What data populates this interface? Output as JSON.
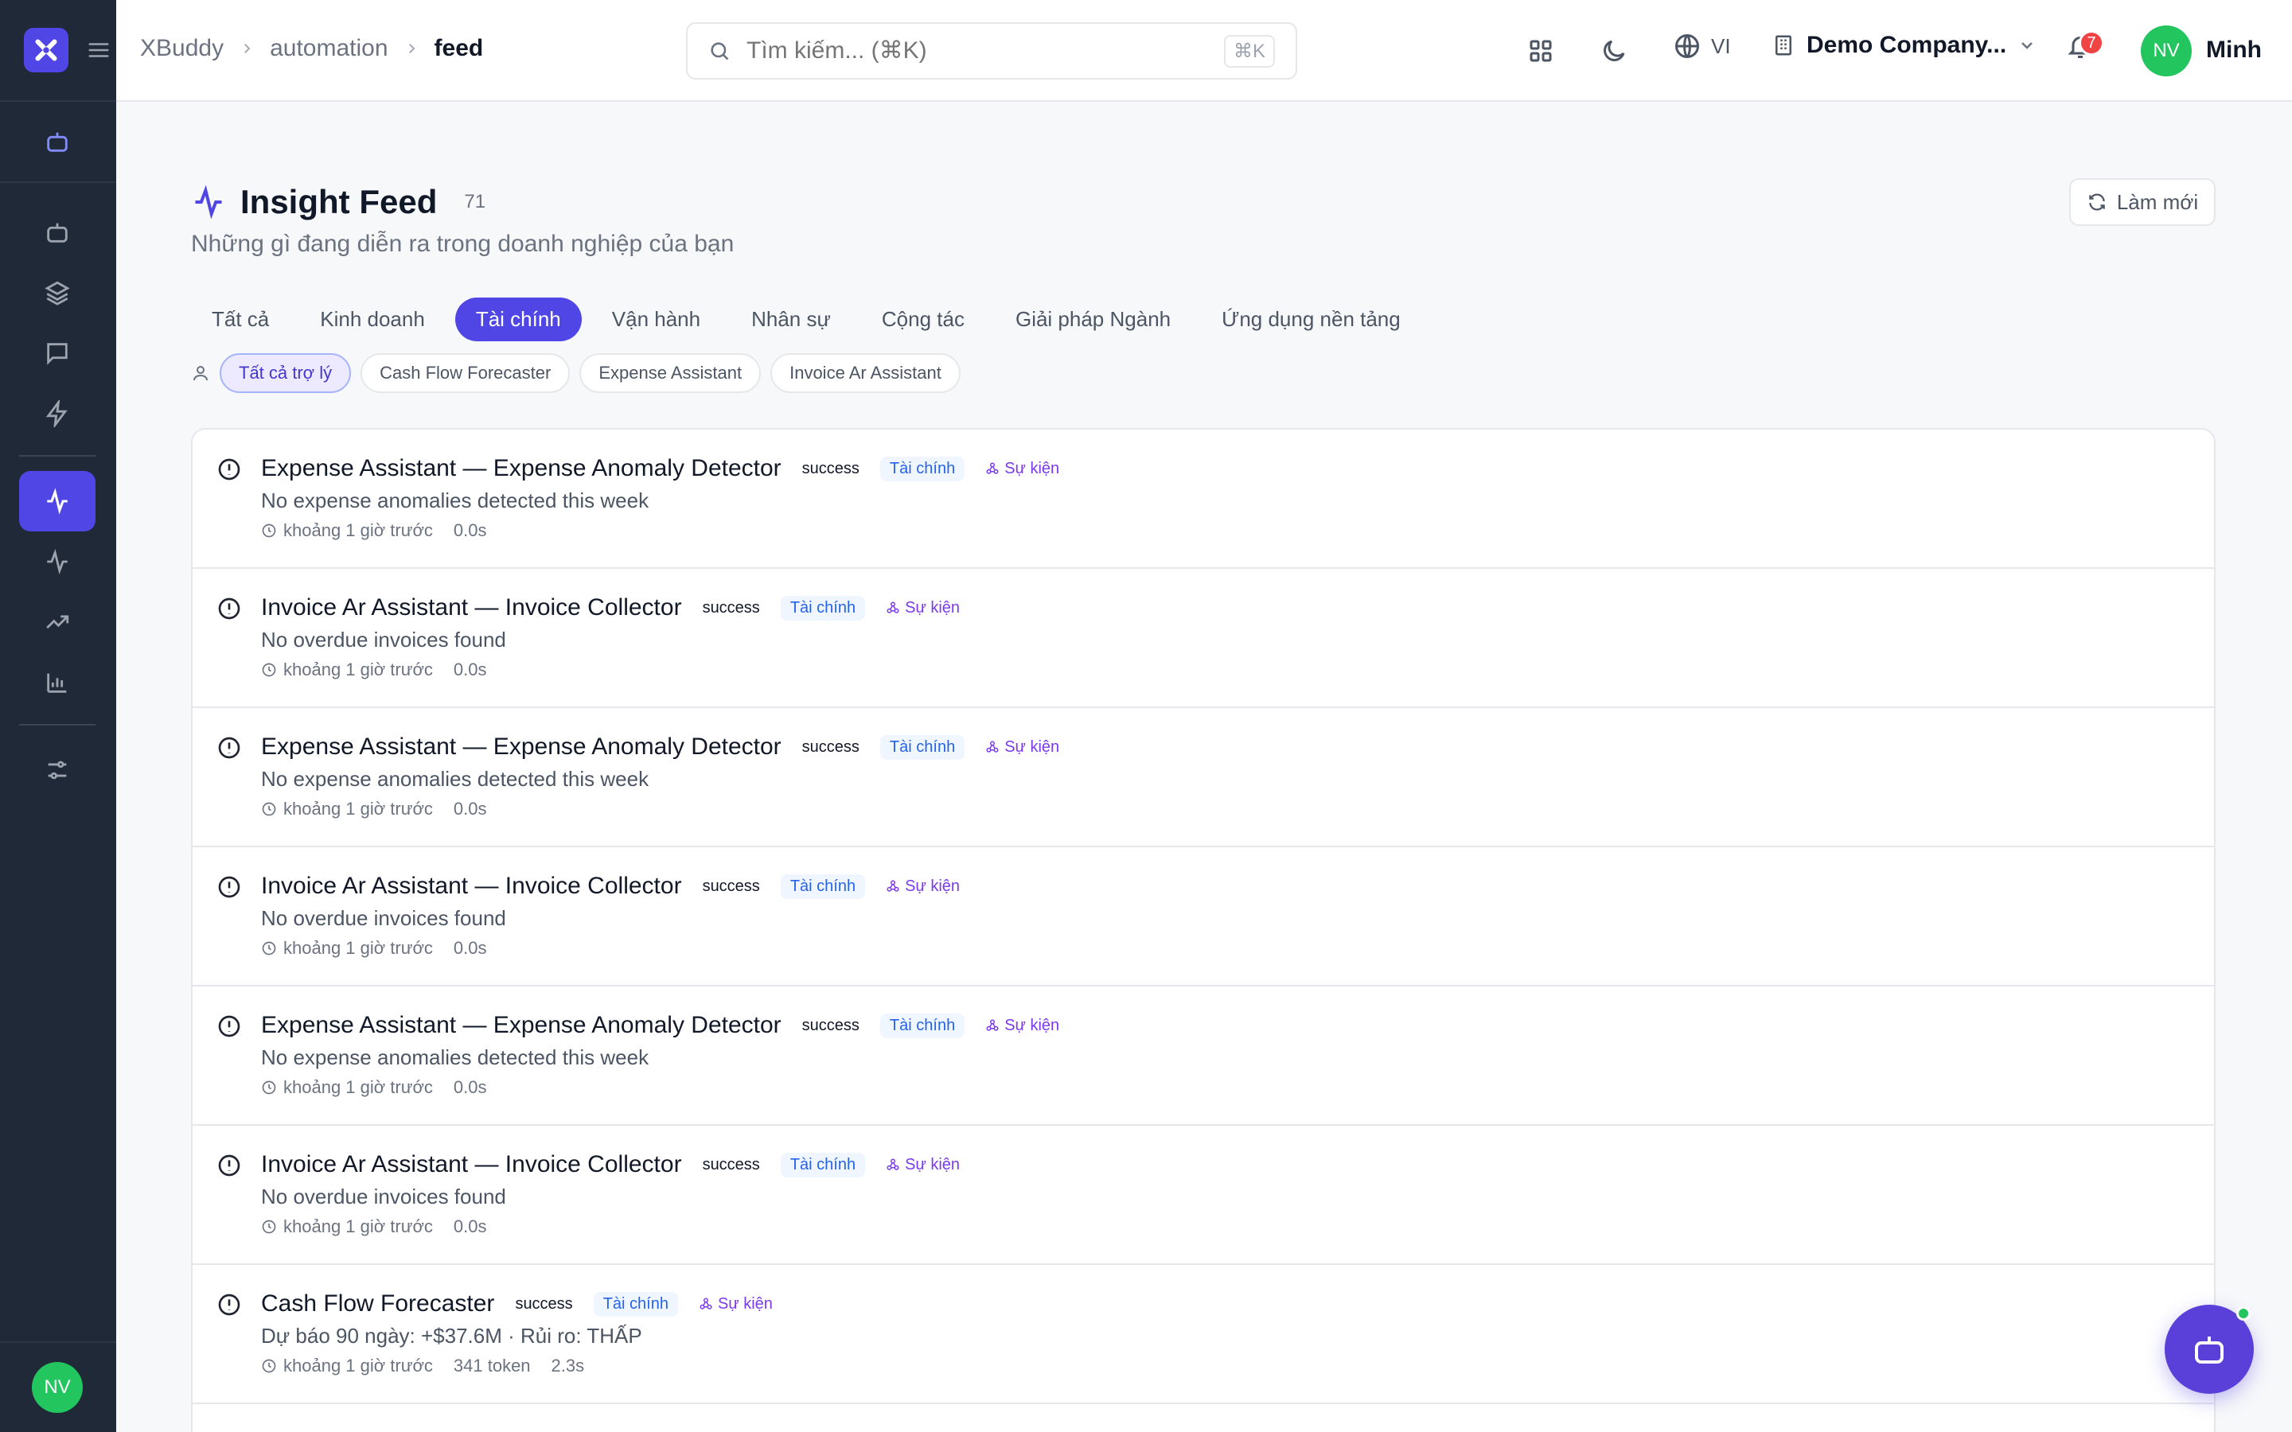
{
  "header": {
    "breadcrumb": [
      "XBuddy",
      "automation",
      "feed"
    ],
    "search_placeholder": "Tìm kiếm... (⌘K)",
    "search_shortcut": "⌘K",
    "language": "VI",
    "company": "Demo Company...",
    "notification_count": "7",
    "user_initials": "NV",
    "user_name": "Minh"
  },
  "sidebar": {
    "avatar_initials": "NV"
  },
  "page": {
    "title": "Insight Feed",
    "count": "71",
    "subtitle": "Những gì đang diễn ra trong doanh nghiệp của bạn",
    "refresh_label": "Làm mới"
  },
  "tabs": [
    "Tất cả",
    "Kinh doanh",
    "Tài chính",
    "Vận hành",
    "Nhân sự",
    "Cộng tác",
    "Giải pháp Ngành",
    "Ứng dụng nền tảng"
  ],
  "active_tab": "Tài chính",
  "assistant_chips": [
    "Tất cả trợ lý",
    "Cash Flow Forecaster",
    "Expense Assistant",
    "Invoice Ar Assistant"
  ],
  "feed": [
    {
      "title": "Expense Assistant — Expense Anomaly Detector",
      "status": "success",
      "category": "Tài chính",
      "event": "Sự kiện",
      "desc": "No expense anomalies detected this week",
      "time": "khoảng 1 giờ trước",
      "tokens": "",
      "duration": "0.0s"
    },
    {
      "title": "Invoice Ar Assistant — Invoice Collector",
      "status": "success",
      "category": "Tài chính",
      "event": "Sự kiện",
      "desc": "No overdue invoices found",
      "time": "khoảng 1 giờ trước",
      "tokens": "",
      "duration": "0.0s"
    },
    {
      "title": "Expense Assistant — Expense Anomaly Detector",
      "status": "success",
      "category": "Tài chính",
      "event": "Sự kiện",
      "desc": "No expense anomalies detected this week",
      "time": "khoảng 1 giờ trước",
      "tokens": "",
      "duration": "0.0s"
    },
    {
      "title": "Invoice Ar Assistant — Invoice Collector",
      "status": "success",
      "category": "Tài chính",
      "event": "Sự kiện",
      "desc": "No overdue invoices found",
      "time": "khoảng 1 giờ trước",
      "tokens": "",
      "duration": "0.0s"
    },
    {
      "title": "Expense Assistant — Expense Anomaly Detector",
      "status": "success",
      "category": "Tài chính",
      "event": "Sự kiện",
      "desc": "No expense anomalies detected this week",
      "time": "khoảng 1 giờ trước",
      "tokens": "",
      "duration": "0.0s"
    },
    {
      "title": "Invoice Ar Assistant — Invoice Collector",
      "status": "success",
      "category": "Tài chính",
      "event": "Sự kiện",
      "desc": "No overdue invoices found",
      "time": "khoảng 1 giờ trước",
      "tokens": "",
      "duration": "0.0s"
    },
    {
      "title": "Cash Flow Forecaster",
      "status": "success",
      "category": "Tài chính",
      "event": "Sự kiện",
      "desc": "Dự báo 90 ngày: +$37.6M · Rủi ro: THẤP",
      "time": "khoảng 1 giờ trước",
      "tokens": "341 token",
      "duration": "2.3s"
    }
  ],
  "colors": {
    "accent": "#4f46e5",
    "sidebar": "#1f2937",
    "success": "#22c55e",
    "danger": "#ef4444"
  }
}
